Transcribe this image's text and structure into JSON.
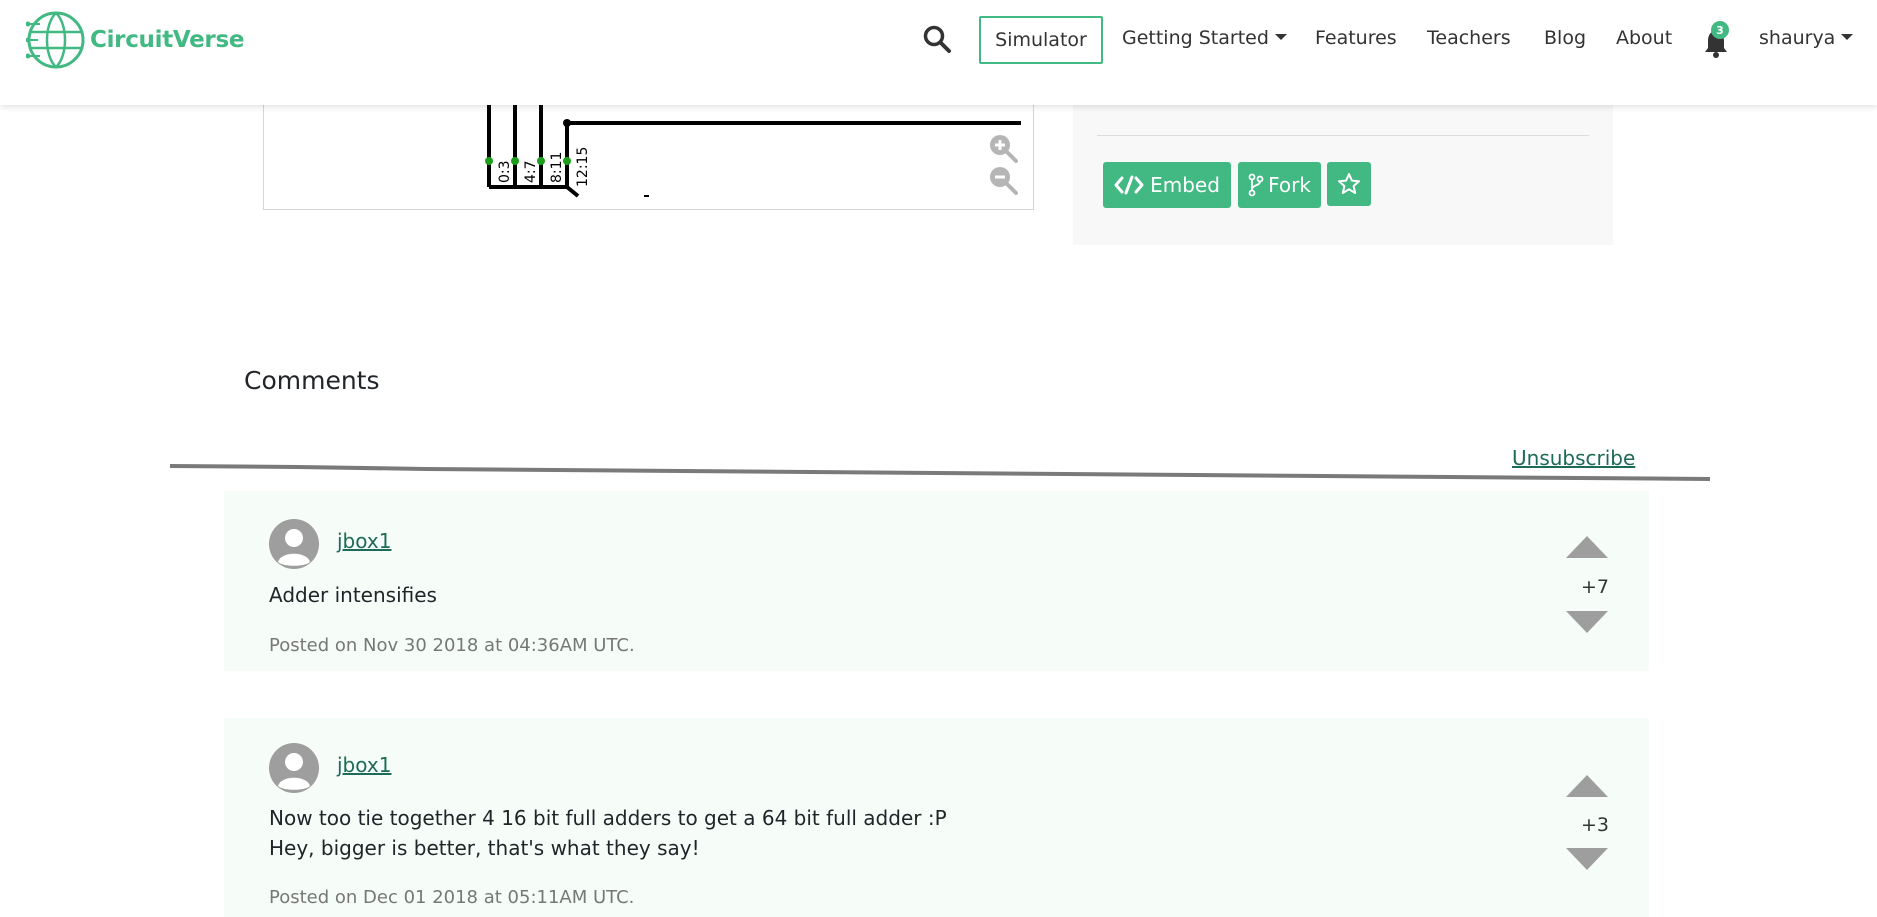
{
  "nav": {
    "brand": "CircuitVerse",
    "simulator": "Simulator",
    "getting_started": "Getting Started",
    "features": "Features",
    "teachers": "Teachers",
    "blog": "Blog",
    "about": "About",
    "notification_count": "3",
    "user": "shaurya",
    "icons": {
      "search": "search-icon",
      "bell": "bell-icon",
      "caret": "caret-down-icon"
    }
  },
  "preview": {
    "labels": [
      "0:3",
      "4:7",
      "8:11",
      "12:15"
    ],
    "zoom_in_icon": "zoom-in-icon",
    "zoom_out_icon": "zoom-out-icon"
  },
  "actions": {
    "embed": "Embed",
    "fork": "Fork",
    "star_icon": "star-icon"
  },
  "comments": {
    "title": "Comments",
    "unsubscribe": "Unsubscribe",
    "items": [
      {
        "author": "jbox1",
        "lines": [
          "Adder intensifies"
        ],
        "meta": "Posted on Nov 30 2018 at 04:36AM UTC.",
        "votes": "+7"
      },
      {
        "author": "jbox1",
        "lines": [
          "Now too tie together 4 16 bit full adders to get a 64 bit full adder :P",
          "Hey, bigger is better, that's what they say!"
        ],
        "meta": "Posted on Dec 01 2018 at 05:11AM UTC.",
        "votes": "+3"
      }
    ]
  },
  "colors": {
    "accent": "#42b983",
    "link": "#1d6b56",
    "comment_bg": "#f6fdf9",
    "panel_bg": "#f8f8f8",
    "vote_arrow": "#9e9e9e"
  }
}
